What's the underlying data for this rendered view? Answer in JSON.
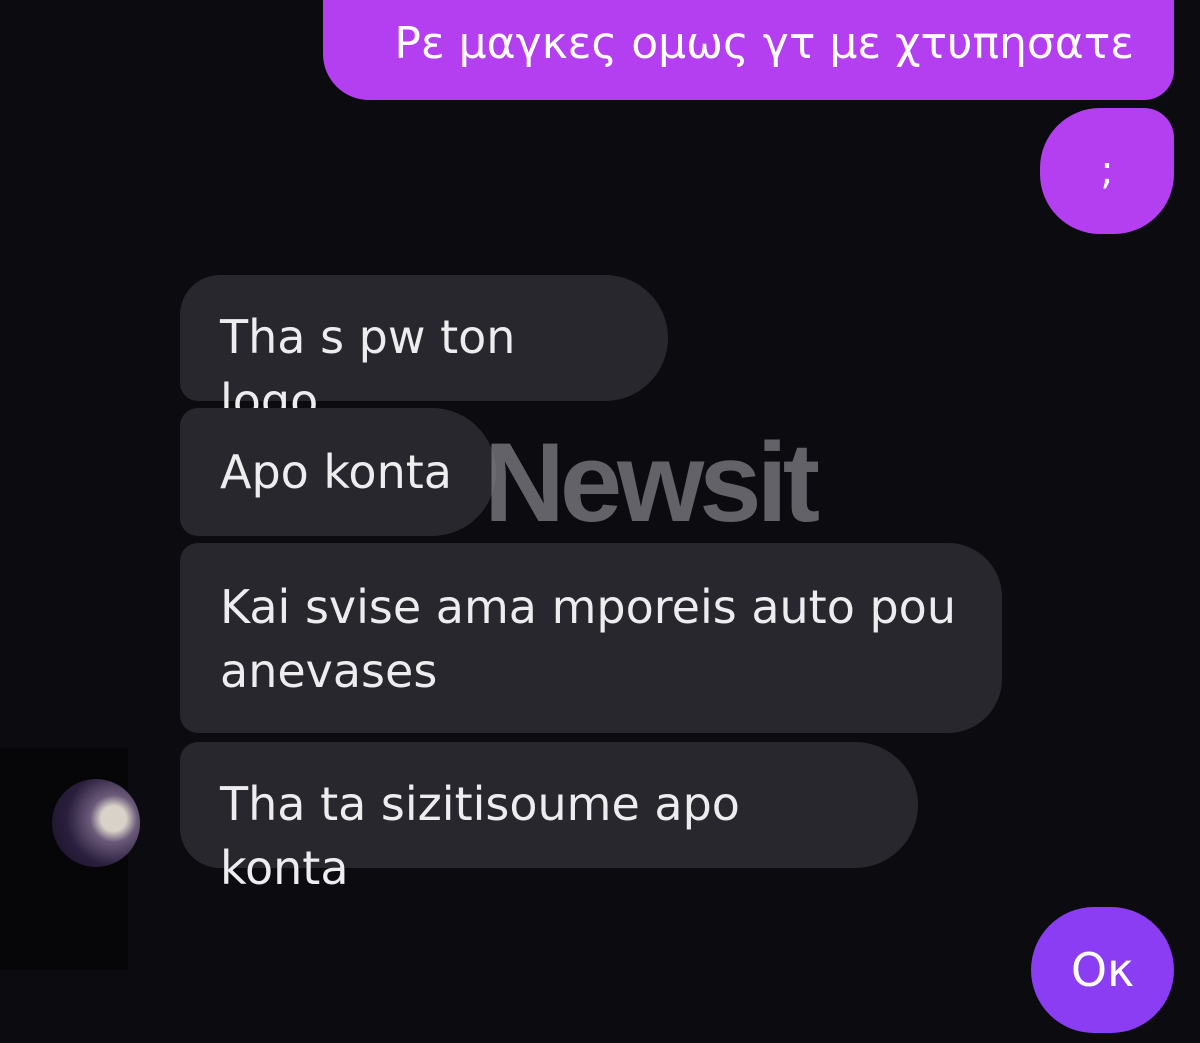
{
  "messages": [
    {
      "id": "m1",
      "direction": "sent",
      "text": "Ρε μαγκες ομως γτ με χτυπησατε"
    },
    {
      "id": "m2",
      "direction": "sent",
      "text": ";"
    },
    {
      "id": "m3",
      "direction": "received",
      "text": "Tha s pw ton logo"
    },
    {
      "id": "m4",
      "direction": "received",
      "text": "Apo konta"
    },
    {
      "id": "m5",
      "direction": "received",
      "text": "Kai svise ama mporeis auto pou anevases"
    },
    {
      "id": "m6",
      "direction": "received",
      "text": "Tha ta sizitisoume apo konta"
    },
    {
      "id": "m7",
      "direction": "sent",
      "text": "Oκ"
    }
  ],
  "watermark": {
    "text": "Newsit"
  },
  "colors": {
    "background": "#0c0c10",
    "sent_bubble": "#b43ff0",
    "sent_bubble_last": "#8a3df2",
    "received_bubble": "#27272d",
    "watermark": "#8c8c92"
  },
  "icons": {
    "avatar": "contact-avatar"
  }
}
